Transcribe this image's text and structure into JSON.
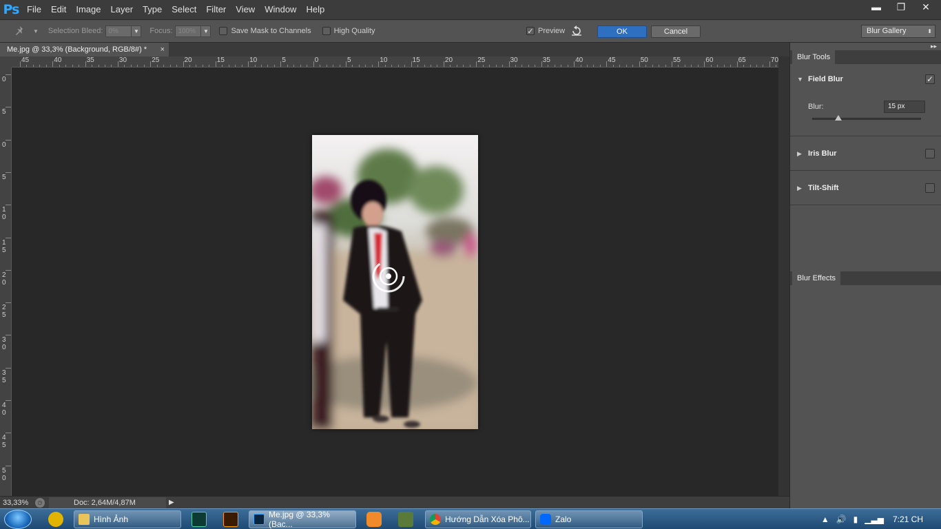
{
  "app": {
    "logo": "Ps"
  },
  "menu": [
    "File",
    "Edit",
    "Image",
    "Layer",
    "Type",
    "Select",
    "Filter",
    "View",
    "Window",
    "Help"
  ],
  "window_controls": {
    "minimize": "▬",
    "restore": "❐",
    "close": "✕"
  },
  "options": {
    "tool_icon": "pin-tool-icon",
    "selection_bleed_label": "Selection Bleed:",
    "selection_bleed_value": "0%",
    "focus_label": "Focus:",
    "focus_value": "100%",
    "save_mask_label": "Save Mask to Channels",
    "high_quality_label": "High Quality",
    "preview_label": "Preview",
    "preview_checked": true,
    "ok_label": "OK",
    "cancel_label": "Cancel",
    "workspace_label": "Blur Gallery"
  },
  "document": {
    "tab_title": "Me.jpg @ 33,3% (Background, RGB/8#) *",
    "close": "×"
  },
  "rulers": {
    "top": [
      "45",
      "40",
      "35",
      "30",
      "25",
      "20",
      "15",
      "10",
      "5",
      "0",
      "5",
      "10",
      "15",
      "20",
      "25",
      "30",
      "35",
      "40",
      "45",
      "50",
      "55",
      "60",
      "65",
      "70"
    ],
    "left": [
      "0",
      "5",
      "0",
      "5",
      "1 0",
      "1 5",
      "2 0",
      "2 5",
      "3 0",
      "3 5",
      "4 0",
      "4 5",
      "5 0"
    ]
  },
  "status": {
    "zoom": "33,33%",
    "doc": "Doc: 2,64M/4,87M"
  },
  "panel": {
    "blur_tools_tab": "Blur Tools",
    "field_blur": {
      "title": "Field Blur",
      "enabled": true,
      "blur_label": "Blur:",
      "blur_value": "15 px",
      "slider_fraction": 0.24
    },
    "iris_blur": {
      "title": "Iris Blur",
      "enabled": false
    },
    "tilt_shift": {
      "title": "Tilt-Shift",
      "enabled": false
    },
    "blur_effects_tab": "Blur Effects"
  },
  "taskbar": {
    "tasks": [
      {
        "label": "Hình Ảnh",
        "icon": "folder-icon"
      },
      {
        "label": "Me.jpg @ 33,3% (Bac...",
        "icon": "photoshop-icon",
        "active": true
      },
      {
        "label": "Hướng Dẫn Xóa Phô...",
        "icon": "chrome-icon"
      },
      {
        "label": "Zalo",
        "icon": "zalo-icon"
      }
    ],
    "clock": "7:21 CH"
  }
}
